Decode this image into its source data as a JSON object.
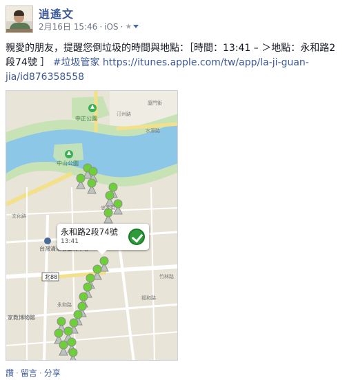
{
  "post": {
    "author": "逍遙文",
    "date": "2月16日 15:46",
    "source": "iOS",
    "audience_icon": "star-icon",
    "message_text": "親愛的朋友，提醒您倒垃圾的時間與地點：［時間：13:41 – ＞地點：永和路2段74號 ］",
    "hashtag": "#垃圾管家",
    "link": "https://itunes.apple.com/tw/app/la-ji-guan-jia/id876358558"
  },
  "map": {
    "callout_title": "永和路2段74號",
    "callout_time": "13:41",
    "river_color": "#8cc7e8",
    "park_color": "#c7e3b5",
    "pin_color": "#6fcf3a",
    "labels": {
      "zhongzheng_park": "中正公園",
      "zhongshan_park": "中山公園",
      "taiwan_center": "台灣清華石墨烯中心",
      "museum": "家教博物館",
      "bei88": "北88",
      "yonghe_rd": "永和路",
      "wenhua_rd": "文化路",
      "zhongxiao_st": "忠孝街",
      "fuhe_rd": "福和路",
      "zhuxiang": "竹林路",
      "shuiyuan_rd": "水源路",
      "xiamen_st": "廈門街",
      "tingzhou_rd": "汀州路"
    }
  },
  "actions": {
    "like": "讚",
    "comment": "留言",
    "share": "分享",
    "separator": "·"
  }
}
